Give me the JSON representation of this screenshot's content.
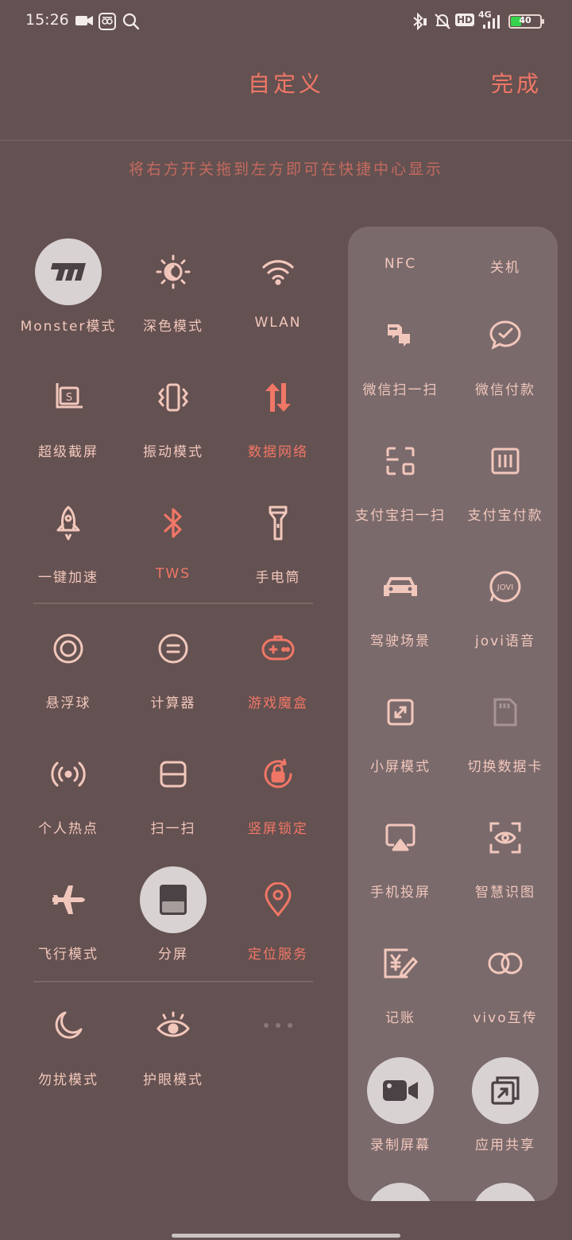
{
  "status_bar": {
    "time": "15:26",
    "network": "4G",
    "hd": "HD",
    "battery_level": "40",
    "battery_fraction": 0.4
  },
  "header": {
    "title": "自定义",
    "done_label": "完成",
    "hint": "将右方开关拖到左方即可在快捷中心显示"
  },
  "active_tiles": [
    {
      "label": "Monster模式",
      "icon": "monster-logo-icon"
    },
    {
      "label": "深色模式",
      "icon": "dark-mode-icon"
    },
    {
      "label": "WLAN",
      "icon": "wifi-icon"
    },
    {
      "label": "超级截屏",
      "icon": "screenshot-icon"
    },
    {
      "label": "振动模式",
      "icon": "vibrate-icon"
    },
    {
      "label": "数据网络",
      "icon": "mobile-data-icon"
    },
    {
      "label": "一键加速",
      "icon": "rocket-icon"
    },
    {
      "label": "TWS",
      "icon": "bluetooth-icon"
    },
    {
      "label": "手电筒",
      "icon": "flashlight-icon"
    },
    {
      "label": "悬浮球",
      "icon": "floating-ball-icon"
    },
    {
      "label": "计算器",
      "icon": "calculator-icon"
    },
    {
      "label": "游戏魔盒",
      "icon": "gamepad-icon"
    },
    {
      "label": "个人热点",
      "icon": "hotspot-icon"
    },
    {
      "label": "扫一扫",
      "icon": "scan-icon"
    },
    {
      "label": "竖屏锁定",
      "icon": "rotation-lock-icon"
    },
    {
      "label": "飞行模式",
      "icon": "airplane-icon"
    },
    {
      "label": "分屏",
      "icon": "split-screen-icon"
    },
    {
      "label": "定位服务",
      "icon": "location-icon"
    },
    {
      "label": "勿扰模式",
      "icon": "moon-icon"
    },
    {
      "label": "护眼模式",
      "icon": "eye-icon"
    }
  ],
  "available_tiles": [
    {
      "label": "NFC",
      "icon": "nfc-icon"
    },
    {
      "label": "关机",
      "icon": "power-icon"
    },
    {
      "label": "微信扫一扫",
      "icon": "wechat-scan-icon"
    },
    {
      "label": "微信付款",
      "icon": "wechat-pay-icon"
    },
    {
      "label": "支付宝扫一扫",
      "icon": "alipay-scan-icon"
    },
    {
      "label": "支付宝付款",
      "icon": "alipay-pay-icon"
    },
    {
      "label": "驾驶场景",
      "icon": "car-icon"
    },
    {
      "label": "jovi语音",
      "icon": "jovi-icon"
    },
    {
      "label": "小屏模式",
      "icon": "small-screen-icon"
    },
    {
      "label": "切换数据卡",
      "icon": "sim-card-icon"
    },
    {
      "label": "手机投屏",
      "icon": "screen-cast-icon"
    },
    {
      "label": "智慧识图",
      "icon": "image-recognition-icon"
    },
    {
      "label": "记账",
      "icon": "bookkeeping-icon"
    },
    {
      "label": "vivo互传",
      "icon": "vivo-share-icon"
    },
    {
      "label": "录制屏幕",
      "icon": "screen-record-icon"
    },
    {
      "label": "应用共享",
      "icon": "app-share-icon"
    }
  ],
  "colors": {
    "background": "#645151",
    "accent_red": "#f07766",
    "label_pink": "#f2c7bb",
    "panel": "#7a6a6c",
    "active_circle": "#d9d2d2"
  }
}
